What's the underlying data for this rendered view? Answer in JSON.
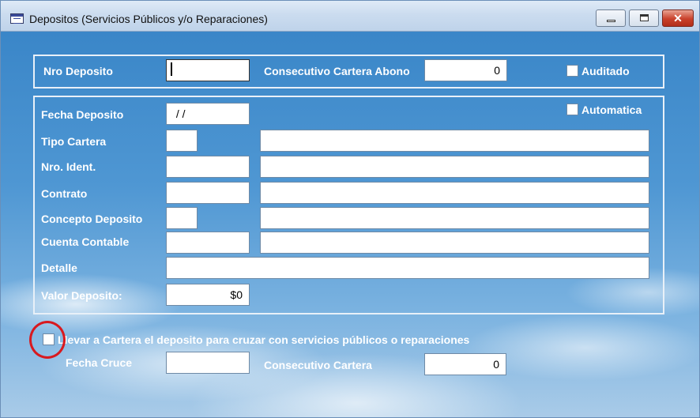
{
  "window": {
    "title": "Depositos (Servicios Públicos y/o Reparaciones)"
  },
  "panel_top": {
    "nro_deposito_label": "Nro Deposito",
    "nro_deposito_value": "",
    "consecutivo_cartera_abono_label": "Consecutivo Cartera Abono",
    "consecutivo_cartera_abono_value": "0",
    "auditado_label": "Auditado"
  },
  "panel_main": {
    "fecha_deposito_label": "Fecha Deposito",
    "fecha_deposito_value": " / /",
    "automatica_label": "Automatica",
    "tipo_cartera_label": "Tipo Cartera",
    "nro_ident_label": "Nro. Ident.",
    "contrato_label": "Contrato",
    "concepto_deposito_label": "Concepto Deposito",
    "cuenta_contable_label": "Cuenta Contable",
    "detalle_label": "Detalle",
    "valor_deposito_label": "Valor Deposito:",
    "valor_deposito_value": "$0"
  },
  "bottom": {
    "llevar_cartera_label": "Llevar a Cartera el deposito para cruzar con servicios públicos o reparaciones",
    "fecha_cruce_label": "Fecha Cruce",
    "fecha_cruce_value": "",
    "consecutivo_cartera_label": "Consecutivo Cartera",
    "consecutivo_cartera_value": "0"
  },
  "colors": {
    "highlight": "#d8191f"
  },
  "icons": {
    "app": "table-icon",
    "minimize": "minimize-icon",
    "maximize": "maximize-icon",
    "close": "close-icon"
  }
}
